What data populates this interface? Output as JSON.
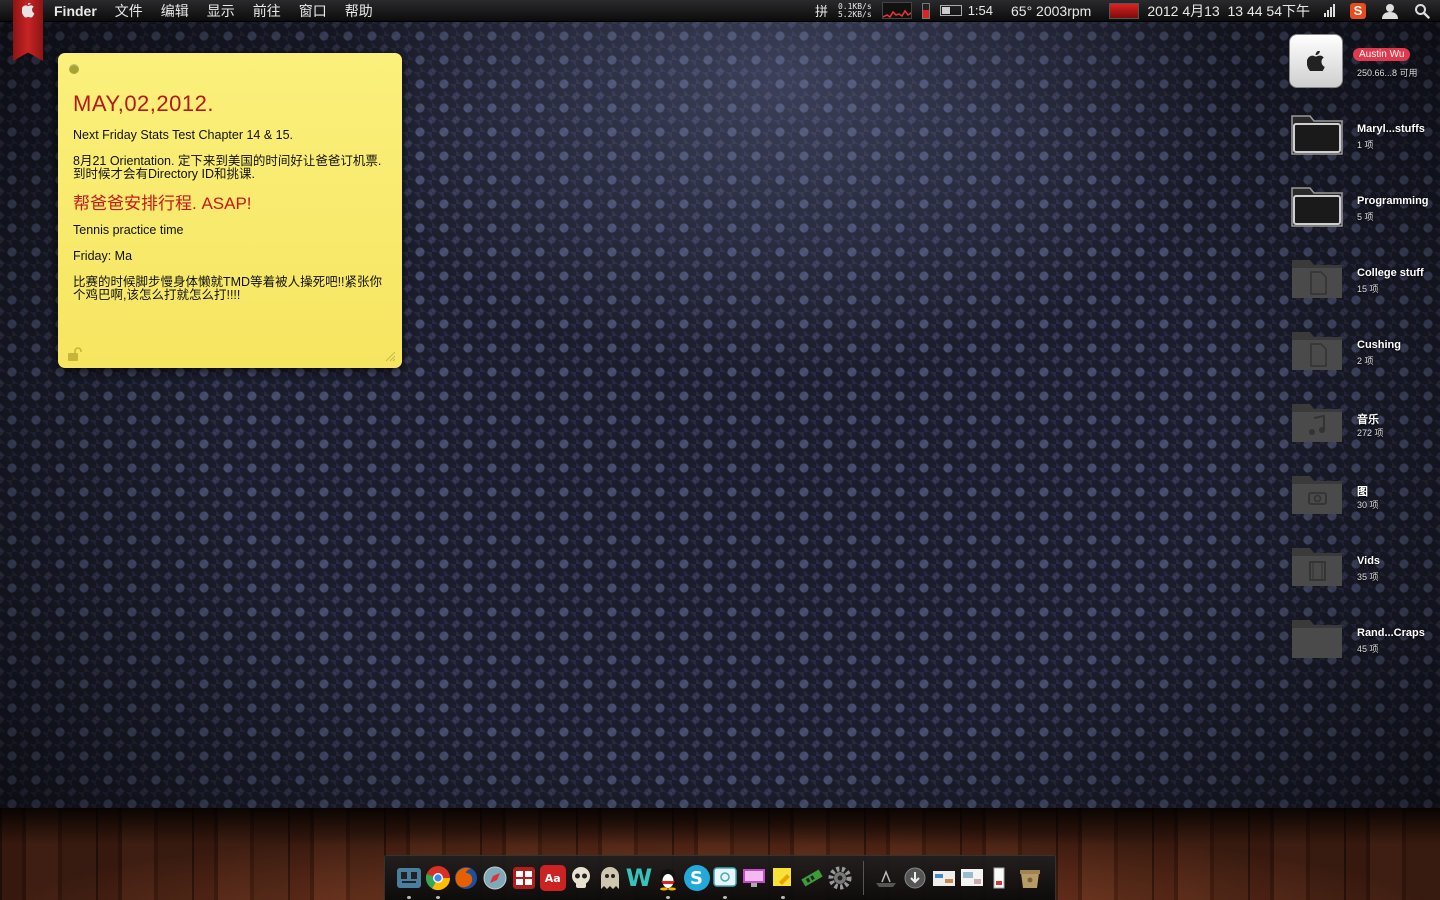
{
  "menubar": {
    "app_name": "Finder",
    "items": [
      "文件",
      "编辑",
      "显示",
      "前往",
      "窗口",
      "帮助"
    ],
    "input_method": "拼",
    "net_up": "0.1KB/s",
    "net_down": "5.2KB/s",
    "battery_time": "1:54",
    "temp_fan": "65° 2003rpm",
    "datetime": "2012 4月13  13 44 54下午"
  },
  "sticky": {
    "title": "MAY,02,2012.",
    "line1": "Next Friday Stats Test Chapter 14 & 15.",
    "line2": "8月21 Orientation. 定下来到美国的时间好让爸爸订机票.到时候才会有Directory ID和挑课.",
    "line3": "帮爸爸安排行程. ASAP!",
    "line4": "Tennis practice time",
    "line5": "Friday: Ma",
    "line6": "比赛的时候脚步慢身体懒就TMD等着被人操死吧!!紧张你个鸡巴啊,该怎么打就怎么打!!!!"
  },
  "desktop": {
    "hd_user": "Austin Wu",
    "hd_sub": "250.66...8 可用",
    "items": [
      {
        "name": "Maryl...stuffs",
        "sub": "1 项"
      },
      {
        "name": "Programming",
        "sub": "5 项"
      },
      {
        "name": "College stuff",
        "sub": "15 项"
      },
      {
        "name": "Cushing",
        "sub": "2 项"
      },
      {
        "name": "音乐",
        "sub": "272 项"
      },
      {
        "name": "图",
        "sub": "30 项"
      },
      {
        "name": "Vids",
        "sub": "35 项"
      },
      {
        "name": "Rand...Craps",
        "sub": "45 项"
      }
    ]
  },
  "dock": {
    "glyph_a": "W",
    "glyph_b": "S",
    "glyph_c": "Aa"
  }
}
